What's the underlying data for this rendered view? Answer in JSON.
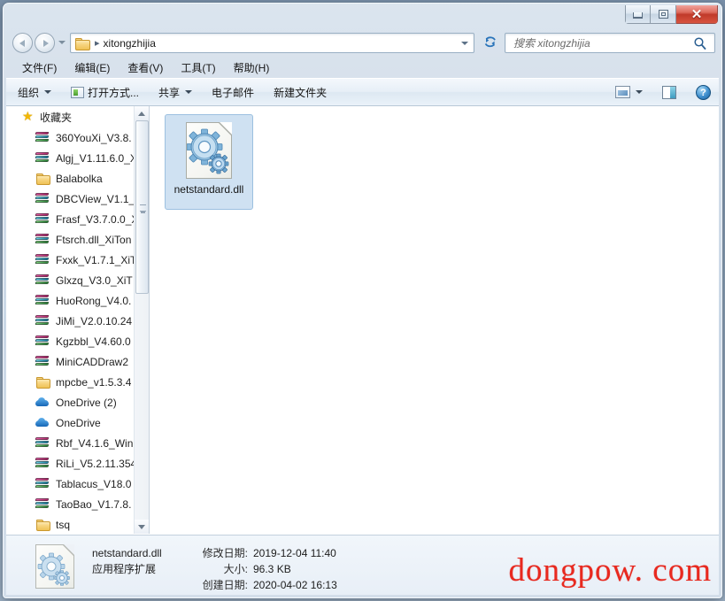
{
  "window": {
    "buttons": {
      "minimize": "minimize",
      "maximize": "maximize",
      "close": "✕"
    }
  },
  "navbar": {
    "back_icon": "back-arrow-icon",
    "forward_icon": "forward-arrow-icon",
    "breadcrumb_separator": "▸",
    "path": "xitongzhijia",
    "dropdown_icon": "chevron-down-icon",
    "refresh_icon": "↯",
    "search_placeholder": "搜索 xitongzhijia",
    "search_value": "",
    "search_icon": "search-icon"
  },
  "menubar": {
    "items": [
      {
        "label": "文件(F)"
      },
      {
        "label": "编辑(E)"
      },
      {
        "label": "查看(V)"
      },
      {
        "label": "工具(T)"
      },
      {
        "label": "帮助(H)"
      }
    ]
  },
  "toolbar": {
    "organize": "组织",
    "open_with": "打开方式...",
    "share": "共享",
    "email": "电子邮件",
    "new_folder": "新建文件夹",
    "view_icon": "view-layout-icon",
    "pane_icon": "preview-pane-icon",
    "help_icon": "?"
  },
  "sidebar": {
    "header": "收藏夹",
    "header_icon": "★",
    "items": [
      {
        "label": "360YouXi_V3.8.",
        "icon": "books"
      },
      {
        "label": "Algj_V1.11.6.0_X",
        "icon": "books"
      },
      {
        "label": "Balabolka",
        "icon": "folder"
      },
      {
        "label": "DBCView_V1.1_",
        "icon": "books"
      },
      {
        "label": "Frasf_V3.7.0.0_X",
        "icon": "books"
      },
      {
        "label": "Ftsrch.dll_XiTon",
        "icon": "books"
      },
      {
        "label": "Fxxk_V1.7.1_XiT",
        "icon": "books"
      },
      {
        "label": "Glxzq_V3.0_XiT",
        "icon": "books"
      },
      {
        "label": "HuoRong_V4.0.",
        "icon": "books"
      },
      {
        "label": "JiMi_V2.0.10.24",
        "icon": "books"
      },
      {
        "label": "Kgzbbl_V4.60.0",
        "icon": "books"
      },
      {
        "label": "MiniCADDraw2",
        "icon": "books"
      },
      {
        "label": "mpcbe_v1.5.3.4",
        "icon": "folder"
      },
      {
        "label": "OneDrive (2)",
        "icon": "cloud"
      },
      {
        "label": "OneDrive",
        "icon": "cloud"
      },
      {
        "label": "Rbf_V4.1.6_Win",
        "icon": "books"
      },
      {
        "label": "RiLi_V5.2.11.354",
        "icon": "books"
      },
      {
        "label": "Tablacus_V18.0",
        "icon": "books"
      },
      {
        "label": "TaoBao_V1.7.8.",
        "icon": "books"
      },
      {
        "label": "tsq",
        "icon": "folder"
      }
    ]
  },
  "filepane": {
    "selected_file": {
      "name": "netstandard.dll",
      "icon": "dll-gear-document-icon"
    }
  },
  "statusbar": {
    "file_name": "netstandard.dll",
    "file_type": "应用程序扩展",
    "modified_label": "修改日期:",
    "modified_value": "2019-12-04 11:40",
    "size_label": "大小:",
    "size_value": "96.3 KB",
    "created_label": "创建日期:",
    "created_value": "2020-04-02 16:13"
  },
  "watermark": {
    "text": "dongpow. com",
    "color": "#e8291f"
  }
}
